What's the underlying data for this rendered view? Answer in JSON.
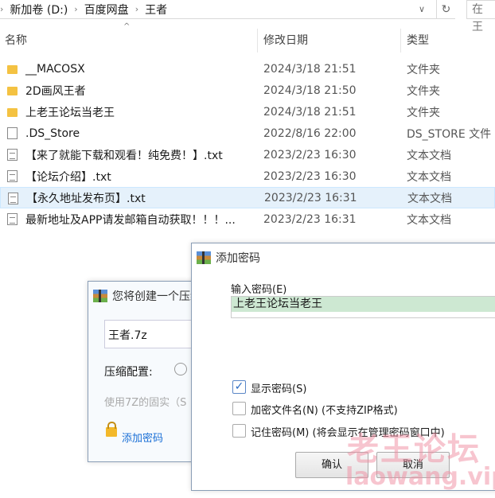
{
  "address": {
    "crumbs": [
      "新加卷 (D:)",
      "百度网盘",
      "王者"
    ],
    "search_placeholder": "在 王"
  },
  "columns": {
    "name": "名称",
    "date": "修改日期",
    "type": "类型"
  },
  "files": [
    {
      "name": "__MACOSX",
      "date": "2024/3/18 21:51",
      "type": "文件夹",
      "icon": "folder"
    },
    {
      "name": "2D画风王者",
      "date": "2024/3/18 21:50",
      "type": "文件夹",
      "icon": "folder"
    },
    {
      "name": "上老王论坛当老王",
      "date": "2024/3/18 21:51",
      "type": "文件夹",
      "icon": "folder"
    },
    {
      "name": ".DS_Store",
      "date": "2022/8/16 22:00",
      "type": "DS_STORE 文件",
      "icon": "file"
    },
    {
      "name": "【来了就能下载和观看！纯免费！】.txt",
      "date": "2023/2/23 16:30",
      "type": "文本文档",
      "icon": "text-file"
    },
    {
      "name": "【论坛介绍】.txt",
      "date": "2023/2/23 16:30",
      "type": "文本文档",
      "icon": "text-file"
    },
    {
      "name": "【永久地址发布页】.txt",
      "date": "2023/2/23 16:31",
      "type": "文本文档",
      "icon": "text-file",
      "selected": true
    },
    {
      "name": "最新地址及APP请发邮箱自动获取！！！...",
      "date": "2023/2/23 16:31",
      "type": "文本文档",
      "icon": "text-file"
    }
  ],
  "archive_dialog": {
    "title": "您将创建一个压缩",
    "filename": "王者.7z",
    "profile_label": "压缩配置:",
    "hint": "使用7Z的固实（S",
    "add_password": "添加密码"
  },
  "password_dialog": {
    "title": "添加密码",
    "input_label": "输入密码(E)",
    "password": "上老王论坛当老王",
    "show_password": {
      "label": "显示密码(S)",
      "checked": true
    },
    "encrypt_names": {
      "label": "加密文件名(N) (不支持ZIP格式)",
      "checked": false
    },
    "remember": {
      "label": "记住密码(M) (将会显示在管理密码窗口中)",
      "checked": false
    },
    "ok": "确认",
    "cancel": "取消"
  },
  "watermark": {
    "line1": "老王论坛",
    "line2": "laowang.vip"
  },
  "colors": {
    "selection": "#e5f1fb",
    "password_highlight": "#cde8d2",
    "link": "#1a6fd6"
  }
}
